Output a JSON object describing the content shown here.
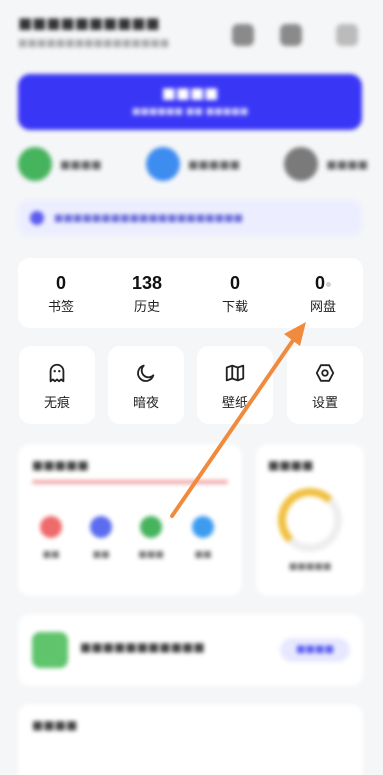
{
  "stats": [
    {
      "value": "0",
      "label": "书签"
    },
    {
      "value": "138",
      "label": "历史"
    },
    {
      "value": "0",
      "label": "下载"
    },
    {
      "value": "0",
      "label": "网盘"
    }
  ],
  "tools": [
    {
      "label": "无痕",
      "icon": "ghost-icon"
    },
    {
      "label": "暗夜",
      "icon": "moon-icon"
    },
    {
      "label": "壁纸",
      "icon": "map-book-icon"
    },
    {
      "label": "设置",
      "icon": "hexagon-settings-icon"
    }
  ],
  "colors": {
    "accent": "#3a36f5",
    "arrow": "#f08a3c"
  }
}
